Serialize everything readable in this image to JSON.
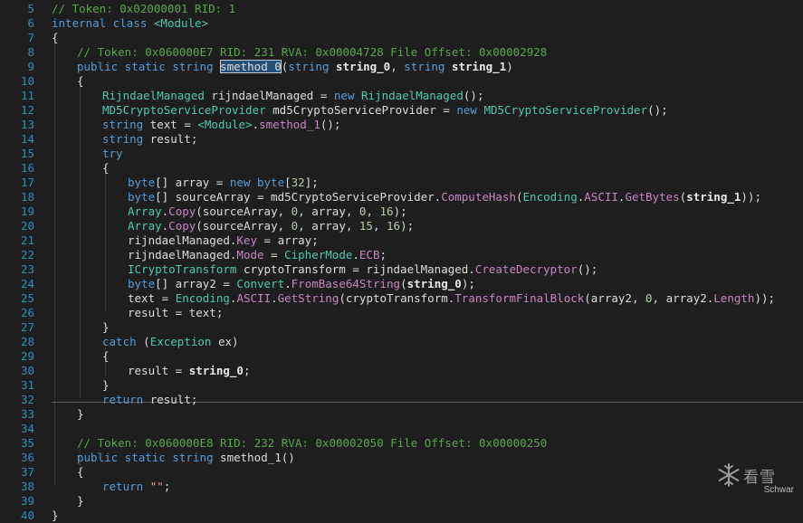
{
  "editor": {
    "lines": [
      {
        "n": "5",
        "ind": 0,
        "segs": [
          [
            "c",
            "// Token: 0x02000001 RID: 1"
          ]
        ]
      },
      {
        "n": "6",
        "ind": 0,
        "segs": [
          [
            "k",
            "internal class "
          ],
          [
            "t",
            "<Module>"
          ]
        ]
      },
      {
        "n": "7",
        "ind": 0,
        "segs": [
          [
            "p",
            "{"
          ]
        ]
      },
      {
        "n": "8",
        "ind": 1,
        "segs": [
          [
            "c",
            "// Token: 0x060000E7 RID: 231 RVA: 0x00004728 File Offset: 0x00002928"
          ]
        ]
      },
      {
        "n": "9",
        "ind": 1,
        "segs": [
          [
            "k",
            "public static string "
          ],
          [
            "hl",
            "smethod_0"
          ],
          [
            "p",
            "("
          ],
          [
            "k",
            "string "
          ],
          [
            "b",
            "string_0"
          ],
          [
            "p",
            ", "
          ],
          [
            "k",
            "string "
          ],
          [
            "b",
            "string_1"
          ],
          [
            "p",
            ")"
          ]
        ]
      },
      {
        "n": "10",
        "ind": 1,
        "segs": [
          [
            "p",
            "{"
          ]
        ]
      },
      {
        "n": "11",
        "ind": 2,
        "segs": [
          [
            "t",
            "RijndaelManaged"
          ],
          [
            "p",
            " rijndaelManaged = "
          ],
          [
            "k",
            "new "
          ],
          [
            "t",
            "RijndaelManaged"
          ],
          [
            "p",
            "();"
          ]
        ]
      },
      {
        "n": "12",
        "ind": 2,
        "segs": [
          [
            "t",
            "MD5CryptoServiceProvider"
          ],
          [
            "p",
            " md5CryptoServiceProvider = "
          ],
          [
            "k",
            "new "
          ],
          [
            "t",
            "MD5CryptoServiceProvider"
          ],
          [
            "p",
            "();"
          ]
        ]
      },
      {
        "n": "13",
        "ind": 2,
        "segs": [
          [
            "k",
            "string "
          ],
          [
            "p",
            "text = "
          ],
          [
            "t",
            "<Module>"
          ],
          [
            "p",
            "."
          ],
          [
            "m",
            "smethod_1"
          ],
          [
            "p",
            "();"
          ]
        ]
      },
      {
        "n": "14",
        "ind": 2,
        "segs": [
          [
            "k",
            "string "
          ],
          [
            "p",
            "result;"
          ]
        ]
      },
      {
        "n": "15",
        "ind": 2,
        "segs": [
          [
            "k",
            "try"
          ]
        ]
      },
      {
        "n": "16",
        "ind": 2,
        "segs": [
          [
            "p",
            "{"
          ]
        ]
      },
      {
        "n": "17",
        "ind": 3,
        "segs": [
          [
            "k",
            "byte"
          ],
          [
            "p",
            "[] array = "
          ],
          [
            "k",
            "new byte"
          ],
          [
            "p",
            "["
          ],
          [
            "n",
            "32"
          ],
          [
            "p",
            "];"
          ]
        ]
      },
      {
        "n": "18",
        "ind": 3,
        "segs": [
          [
            "k",
            "byte"
          ],
          [
            "p",
            "[] sourceArray = md5CryptoServiceProvider."
          ],
          [
            "m",
            "ComputeHash"
          ],
          [
            "p",
            "("
          ],
          [
            "t",
            "Encoding"
          ],
          [
            "p",
            "."
          ],
          [
            "m",
            "ASCII"
          ],
          [
            "p",
            "."
          ],
          [
            "m",
            "GetBytes"
          ],
          [
            "p",
            "("
          ],
          [
            "b",
            "string_1"
          ],
          [
            "p",
            "));"
          ]
        ]
      },
      {
        "n": "19",
        "ind": 3,
        "segs": [
          [
            "t",
            "Array"
          ],
          [
            "p",
            "."
          ],
          [
            "m",
            "Copy"
          ],
          [
            "p",
            "(sourceArray, "
          ],
          [
            "n",
            "0"
          ],
          [
            "p",
            ", array, "
          ],
          [
            "n",
            "0"
          ],
          [
            "p",
            ", "
          ],
          [
            "n",
            "16"
          ],
          [
            "p",
            ");"
          ]
        ]
      },
      {
        "n": "20",
        "ind": 3,
        "segs": [
          [
            "t",
            "Array"
          ],
          [
            "p",
            "."
          ],
          [
            "m",
            "Copy"
          ],
          [
            "p",
            "(sourceArray, "
          ],
          [
            "n",
            "0"
          ],
          [
            "p",
            ", array, "
          ],
          [
            "n",
            "15"
          ],
          [
            "p",
            ", "
          ],
          [
            "n",
            "16"
          ],
          [
            "p",
            ");"
          ]
        ]
      },
      {
        "n": "21",
        "ind": 3,
        "segs": [
          [
            "p",
            "rijndaelManaged."
          ],
          [
            "m",
            "Key"
          ],
          [
            "p",
            " = array;"
          ]
        ]
      },
      {
        "n": "22",
        "ind": 3,
        "segs": [
          [
            "p",
            "rijndaelManaged."
          ],
          [
            "m",
            "Mode"
          ],
          [
            "p",
            " = "
          ],
          [
            "t",
            "CipherMode"
          ],
          [
            "p",
            "."
          ],
          [
            "m",
            "ECB"
          ],
          [
            "p",
            ";"
          ]
        ]
      },
      {
        "n": "23",
        "ind": 3,
        "segs": [
          [
            "t",
            "ICryptoTransform"
          ],
          [
            "p",
            " cryptoTransform = rijndaelManaged."
          ],
          [
            "m",
            "CreateDecryptor"
          ],
          [
            "p",
            "();"
          ]
        ]
      },
      {
        "n": "24",
        "ind": 3,
        "segs": [
          [
            "k",
            "byte"
          ],
          [
            "p",
            "[] array2 = "
          ],
          [
            "t",
            "Convert"
          ],
          [
            "p",
            "."
          ],
          [
            "m",
            "FromBase64String"
          ],
          [
            "p",
            "("
          ],
          [
            "b",
            "string_0"
          ],
          [
            "p",
            ");"
          ]
        ]
      },
      {
        "n": "25",
        "ind": 3,
        "segs": [
          [
            "p",
            "text = "
          ],
          [
            "t",
            "Encoding"
          ],
          [
            "p",
            "."
          ],
          [
            "m",
            "ASCII"
          ],
          [
            "p",
            "."
          ],
          [
            "m",
            "GetString"
          ],
          [
            "p",
            "(cryptoTransform."
          ],
          [
            "m",
            "TransformFinalBlock"
          ],
          [
            "p",
            "(array2, "
          ],
          [
            "n",
            "0"
          ],
          [
            "p",
            ", array2."
          ],
          [
            "m",
            "Length"
          ],
          [
            "p",
            "));"
          ]
        ]
      },
      {
        "n": "26",
        "ind": 3,
        "segs": [
          [
            "p",
            "result = text;"
          ]
        ]
      },
      {
        "n": "27",
        "ind": 2,
        "segs": [
          [
            "p",
            "}"
          ]
        ]
      },
      {
        "n": "28",
        "ind": 2,
        "segs": [
          [
            "k",
            "catch "
          ],
          [
            "p",
            "("
          ],
          [
            "t",
            "Exception"
          ],
          [
            "p",
            " ex)"
          ]
        ]
      },
      {
        "n": "29",
        "ind": 2,
        "segs": [
          [
            "p",
            "{"
          ]
        ]
      },
      {
        "n": "30",
        "ind": 3,
        "segs": [
          [
            "p",
            "result = "
          ],
          [
            "b",
            "string_0"
          ],
          [
            "p",
            ";"
          ]
        ]
      },
      {
        "n": "31",
        "ind": 2,
        "segs": [
          [
            "p",
            "}"
          ]
        ]
      },
      {
        "n": "32",
        "ind": 2,
        "segs": [
          [
            "k",
            "return "
          ],
          [
            "p",
            "result;"
          ]
        ]
      },
      {
        "n": "33",
        "ind": 1,
        "segs": [
          [
            "p",
            "}"
          ]
        ]
      },
      {
        "n": "34",
        "ind": 0,
        "segs": []
      },
      {
        "n": "35",
        "ind": 1,
        "segs": [
          [
            "c",
            "// Token: 0x060000E8 RID: 232 RVA: 0x00002050 File Offset: 0x00000250"
          ]
        ]
      },
      {
        "n": "36",
        "ind": 1,
        "segs": [
          [
            "k",
            "public static string "
          ],
          [
            "p",
            "smethod_1()"
          ]
        ]
      },
      {
        "n": "37",
        "ind": 1,
        "segs": [
          [
            "p",
            "{"
          ]
        ]
      },
      {
        "n": "38",
        "ind": 2,
        "segs": [
          [
            "k",
            "return "
          ],
          [
            "s",
            "\"\""
          ],
          [
            "p",
            ";"
          ]
        ]
      },
      {
        "n": "39",
        "ind": 1,
        "segs": [
          [
            "p",
            "}"
          ]
        ]
      },
      {
        "n": "40",
        "ind": 0,
        "segs": [
          [
            "p",
            "}"
          ]
        ]
      }
    ]
  },
  "watermark": {
    "brand": "看雪",
    "author": "Schwar"
  },
  "icons": {
    "watermark_logo": "snowflake-icon"
  }
}
